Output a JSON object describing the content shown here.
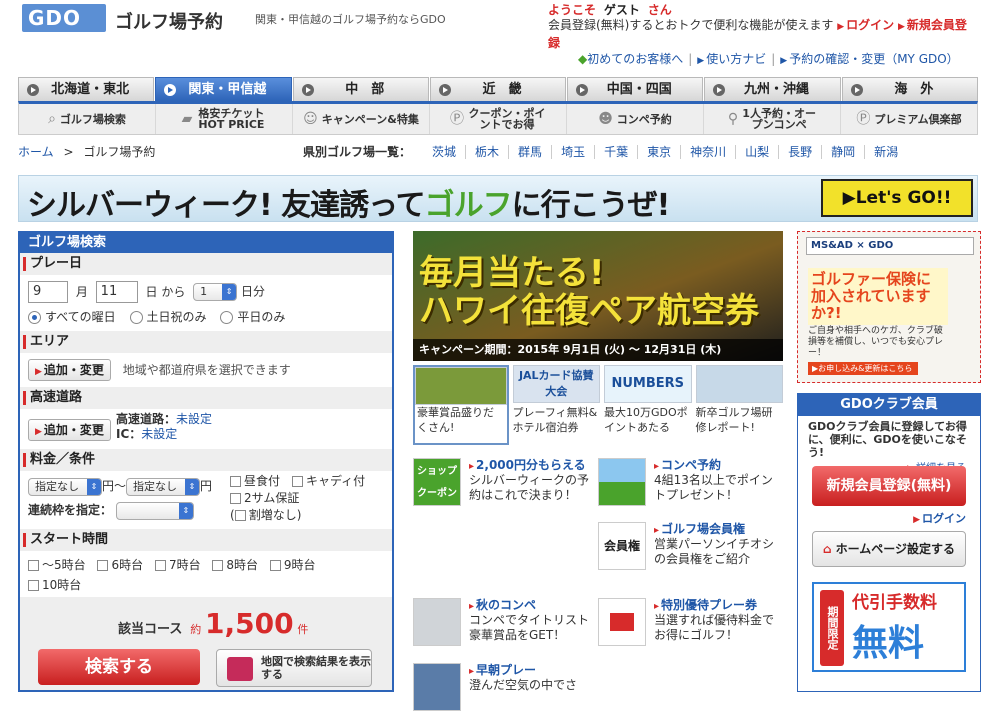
{
  "header": {
    "logo": "GDO",
    "site_title": "ゴルフ場予約",
    "tagline": "関東・甲信越のゴルフ場予約ならGDO",
    "welcome_prefix": "ようこそ",
    "welcome_name": "ゲスト",
    "welcome_suffix": "さん",
    "promo_text": "会員登録(無料)するとおトクで便利な機能が使えます",
    "login_link": "ログイン",
    "register_link": "新規会員登録",
    "links": [
      "初めてのお客様へ",
      "使い方ナビ",
      "予約の確認・変更（MY GDO）"
    ]
  },
  "region_tabs": [
    {
      "label": "北海道・東北",
      "active": false
    },
    {
      "label": "関東・甲信越",
      "active": true
    },
    {
      "label": "中　部",
      "active": false
    },
    {
      "label": "近　畿",
      "active": false
    },
    {
      "label": "中国・四国",
      "active": false
    },
    {
      "label": "九州・沖縄",
      "active": false
    },
    {
      "label": "海　外",
      "active": false
    }
  ],
  "sub_nav": [
    {
      "icon": "magnifier-icon",
      "label": "ゴルフ場検索"
    },
    {
      "icon": "ticket-icon",
      "label": "格安チケット HOT PRICE"
    },
    {
      "icon": "people-icon",
      "label": "キャンペーン&特集"
    },
    {
      "icon": "points-icon",
      "label": "クーポン・ポイントでお得"
    },
    {
      "icon": "group-icon",
      "label": "コンペ予約"
    },
    {
      "icon": "golfer-icon",
      "label": "1人予約・オープンコンペ"
    },
    {
      "icon": "premium-icon",
      "label": "プレミアム倶楽部"
    }
  ],
  "breadcrumb": {
    "home": "ホーム",
    "sep": ">",
    "current": "ゴルフ場予約"
  },
  "prefectures": {
    "label": "県別ゴルフ場一覧：",
    "items": [
      "茨城",
      "栃木",
      "群馬",
      "埼玉",
      "千葉",
      "東京",
      "神奈川",
      "山梨",
      "長野",
      "静岡",
      "新潟"
    ]
  },
  "banner": {
    "text_a": "シルバーウィーク! 友達誘って",
    "text_b": "ゴルフ",
    "text_c": "に行こうぜ!",
    "button": "▶Let's GO!!"
  },
  "search": {
    "title": "ゴルフ場検索",
    "play_date_label": "プレー日",
    "month": "9",
    "month_unit": "月",
    "day": "11",
    "day_unit": "日 から",
    "duration": "1",
    "duration_unit": "日分",
    "day_filters": [
      "すべての曜日",
      "土日祝のみ",
      "平日のみ"
    ],
    "area_label": "エリア",
    "add_change": "追加・変更",
    "area_hint": "地域や都道府県を選択できます",
    "highway_label": "高速道路",
    "highway_name_label": "高速道路：",
    "highway_value": "未設定",
    "ic_label": "IC：",
    "ic_value": "未設定",
    "price_label": "料金／条件",
    "price_min": "指定なし",
    "price_mid": "円〜",
    "price_max": "指定なし",
    "price_unit": "円",
    "conditions": [
      "昼食付",
      "キャディ付",
      "2サム保証",
      "割増なし"
    ],
    "consecutive_label": "連続枠を指定：",
    "start_label": "スタート時間",
    "times": [
      "〜5時台",
      "6時台",
      "7時台",
      "8時台",
      "9時台",
      "10時台"
    ],
    "result_label": "該当コース",
    "result_approx": "約",
    "result_count": "1,500",
    "result_unit": "件",
    "search_button": "検索する",
    "map_button": "地図で検索結果を表示する"
  },
  "campaign": {
    "line1": "毎月当たる!",
    "line2": "ハワイ往復ペア航空券",
    "period": "キャンペーン期間：2015年 9月1日 (火) 〜 12月31日 (木)"
  },
  "thumbs": [
    {
      "pic": "",
      "caption": "豪華賞品盛りだくさん!"
    },
    {
      "pic": "JALカード協賛大会",
      "caption": "プレーフィ無料&ホテル宿泊券"
    },
    {
      "pic": "NUMBERS",
      "caption": "最大10万GDOポイントあたる"
    },
    {
      "pic": "",
      "caption": "新卒ゴルフ場研修レポート!"
    }
  ],
  "features_left": [
    {
      "icon": "shop-coupon-icon",
      "pic": "ショップクーポン",
      "title": "2,000円分もらえる",
      "desc": "シルバーウィークの予約はこれで決まり！"
    },
    {
      "icon": "golf-clubs-icon",
      "pic": "",
      "title": "秋のコンペ",
      "desc": "コンペでタイトリスト豪華賞品をGET！"
    },
    {
      "icon": "golfer-photo-icon",
      "pic": "",
      "title": "早朝プレー",
      "desc": "澄んだ空気の中でさ"
    }
  ],
  "features_right": [
    {
      "icon": "course-icon",
      "pic": "",
      "title": "コンペ予約",
      "desc": "4組13名以上でポイントプレゼント！"
    },
    {
      "icon": "membership-icon",
      "pic": "会員権",
      "title": "ゴルフ場会員権",
      "desc": "営業パーソンイチオシの会員権をご紹介"
    },
    {
      "icon": "gift-icon",
      "pic": "",
      "title": "特別優待プレー券",
      "desc": "当選すれば優待料金でお得にゴルフ！"
    }
  ],
  "insurance_ad": {
    "header": "MS&AD × GDO",
    "headline": "ゴルファー保険に加入されていますか?!",
    "desc": "ご自身や相手へのケガ、クラブ破損等を補償し、いつでも安心プレー！",
    "footer": "▶お申し込み&更新はこちら"
  },
  "club": {
    "title": "GDOクラブ会員",
    "desc": "GDOクラブ会員に登録してお得に、便利に、GDOを使いこなそう!",
    "more": "詳細を見る",
    "register": "新規会員登録(無料)",
    "login": "ログイン",
    "homepage": "ホームページ設定する",
    "free_vertical": "期間限定",
    "free_line1": "代引手数料",
    "free_line2": "無料"
  },
  "colors": {
    "brand_blue": "#2d64b8",
    "accent_red": "#d72b2b",
    "link": "#1f56a7",
    "banner_yellow": "#f2e12a"
  }
}
